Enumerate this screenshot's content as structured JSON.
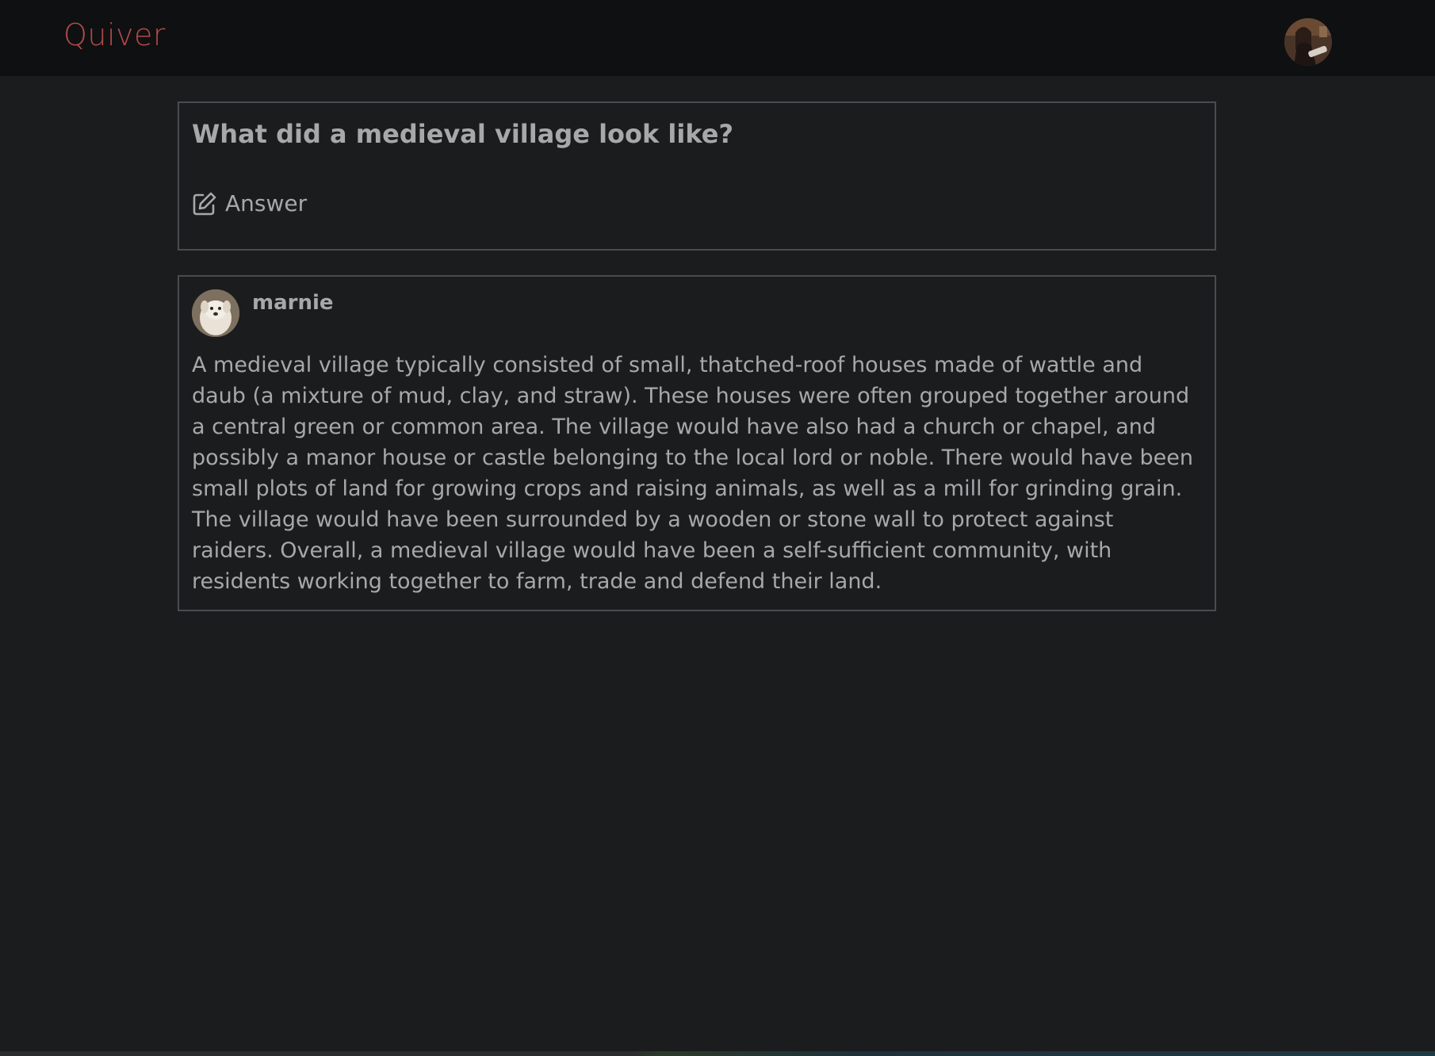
{
  "header": {
    "brand": "Quiver",
    "user_avatar": "user-avatar"
  },
  "question": {
    "title": "What did a medieval village look like?",
    "answer_button": {
      "icon": "edit-icon",
      "label": "Answer"
    }
  },
  "answer": {
    "author": "marnie",
    "avatar": "dog-avatar",
    "text": "A medieval village typically consisted of small, thatched-roof houses made of wattle and daub (a mixture of mud, clay, and straw). These houses were often grouped together around a central green or common area. The village would have also had a church or chapel, and possibly a manor house or castle belonging to the local lord or noble. There would have been small plots of land for growing crops and raising animals, as well as a mill for grinding grain. The village would have been surrounded by a wooden or stone wall to protect against raiders. Overall, a medieval village would have been a self-sufficient community, with residents working together to farm, trade and defend their land."
  },
  "colors": {
    "background": "#1b1c1e",
    "topbar": "#0f1012",
    "brand": "#b24a47",
    "text": "#a7a8aa",
    "border": "#4a4b4e"
  }
}
